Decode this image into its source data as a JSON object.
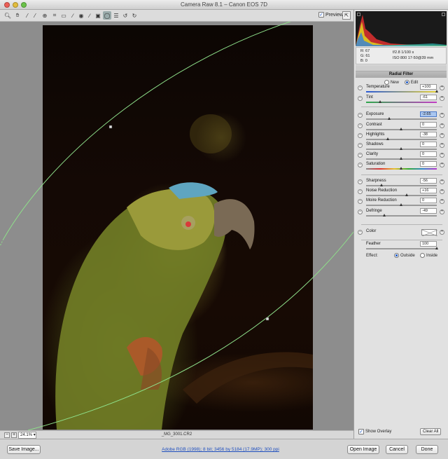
{
  "window": {
    "title": "Camera Raw 8.1  –  Canon EOS 7D"
  },
  "toolbar": {
    "tools": [
      "zoom-icon",
      "hand-icon",
      "white-balance-icon",
      "color-sampler-icon",
      "targeted-adjustment-icon",
      "crop-icon",
      "straighten-icon",
      "spot-removal-icon",
      "red-eye-icon",
      "adjustment-brush-icon",
      "graduated-filter-icon",
      "radial-filter-icon",
      "preferences-icon",
      "rotate-ccw-icon",
      "rotate-cw-icon"
    ],
    "preview_label": "Preview",
    "preview_checked": true
  },
  "canvas": {
    "zoom": "24.1%",
    "filename": "_MG_3001.CR2"
  },
  "info": {
    "r": "R:  67",
    "g": "G:  61",
    "b": "B:   0",
    "aperture_shutter": "f/2.8   1/100 s",
    "iso_lens": "ISO 800   17-50@39 mm"
  },
  "radial_filter": {
    "title": "Radial Filter",
    "mode_new": "New",
    "mode_edit": "Edit",
    "selected_mode": "Edit",
    "sliders": [
      {
        "label": "Temperature",
        "value": "+100",
        "track": "temp",
        "pos": 1.0
      },
      {
        "label": "Tint",
        "value": "-61",
        "track": "tint",
        "pos": 0.2
      },
      {
        "label": "Exposure",
        "value": "-2.65",
        "track": "plain",
        "pos": 0.33,
        "highlight": true
      },
      {
        "label": "Contrast",
        "value": "0",
        "track": "plain",
        "pos": 0.5
      },
      {
        "label": "Highlights",
        "value": "-38",
        "track": "plain",
        "pos": 0.31
      },
      {
        "label": "Shadows",
        "value": "0",
        "track": "plain",
        "pos": 0.5
      },
      {
        "label": "Clarity",
        "value": "0",
        "track": "plain",
        "pos": 0.5
      },
      {
        "label": "Saturation",
        "value": "0",
        "track": "sat",
        "pos": 0.5
      },
      {
        "label": "Sharpness",
        "value": "-56",
        "track": "plain",
        "pos": 0.22
      },
      {
        "label": "Noise Reduction",
        "value": "+16",
        "track": "plain",
        "pos": 0.58
      },
      {
        "label": "Moire Reduction",
        "value": "0",
        "track": "plain",
        "pos": 0.5
      },
      {
        "label": "Defringe",
        "value": "-49",
        "track": "plain",
        "pos": 0.26
      }
    ],
    "color_label": "Color",
    "feather_label": "Feather",
    "feather_value": "100",
    "effect_label": "Effect:",
    "effect_outside": "Outside",
    "effect_inside": "Inside",
    "effect_selected": "Outside",
    "show_overlay_label": "Show Overlay",
    "show_overlay_checked": true,
    "clear_all_label": "Clear All"
  },
  "footer": {
    "save_image": "Save Image...",
    "workflow_link": "Adobe RGB (1998); 8 bit; 3456 by 5184 (17.9MP); 300 ppi",
    "open_image": "Open Image",
    "cancel": "Cancel",
    "done": "Done"
  },
  "colors": {
    "accent": "#1a56c4",
    "overlay_line": "#7fd67a"
  }
}
